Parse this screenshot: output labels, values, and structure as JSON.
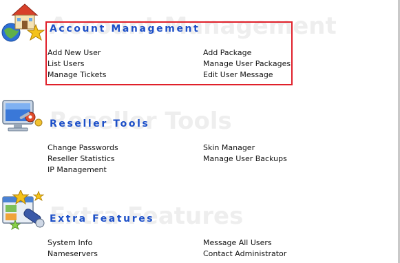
{
  "sections": {
    "account": {
      "watermark": "Account Management",
      "title": "Account Management",
      "icon": "house-globe-star-icon",
      "links": {
        "add_new_user": "Add New User",
        "add_package": "Add Package",
        "list_users": "List Users",
        "manage_user_packages": "Manage User Packages",
        "manage_tickets": "Manage Tickets",
        "edit_user_message": "Edit User Message"
      }
    },
    "reseller": {
      "watermark": "Reseller Tools",
      "title": "Reseller Tools",
      "icon": "monitor-tools-icon",
      "links": {
        "change_passwords": "Change Passwords",
        "skin_manager": "Skin Manager",
        "reseller_statistics": "Reseller Statistics",
        "manage_user_backups": "Manage User Backups",
        "ip_management": "IP Management"
      }
    },
    "extra": {
      "watermark": "Extra Features",
      "title": "Extra Features",
      "icon": "window-stars-telescope-icon",
      "links": {
        "system_info": "System Info",
        "message_all_users": "Message All Users",
        "nameservers": "Nameservers",
        "contact_administrator": "Contact Administrator"
      }
    }
  },
  "colors": {
    "section_title": "#1c4fc8",
    "link_text": "#111111",
    "watermark": "#eeeeee",
    "highlight_border": "#e0202a"
  }
}
